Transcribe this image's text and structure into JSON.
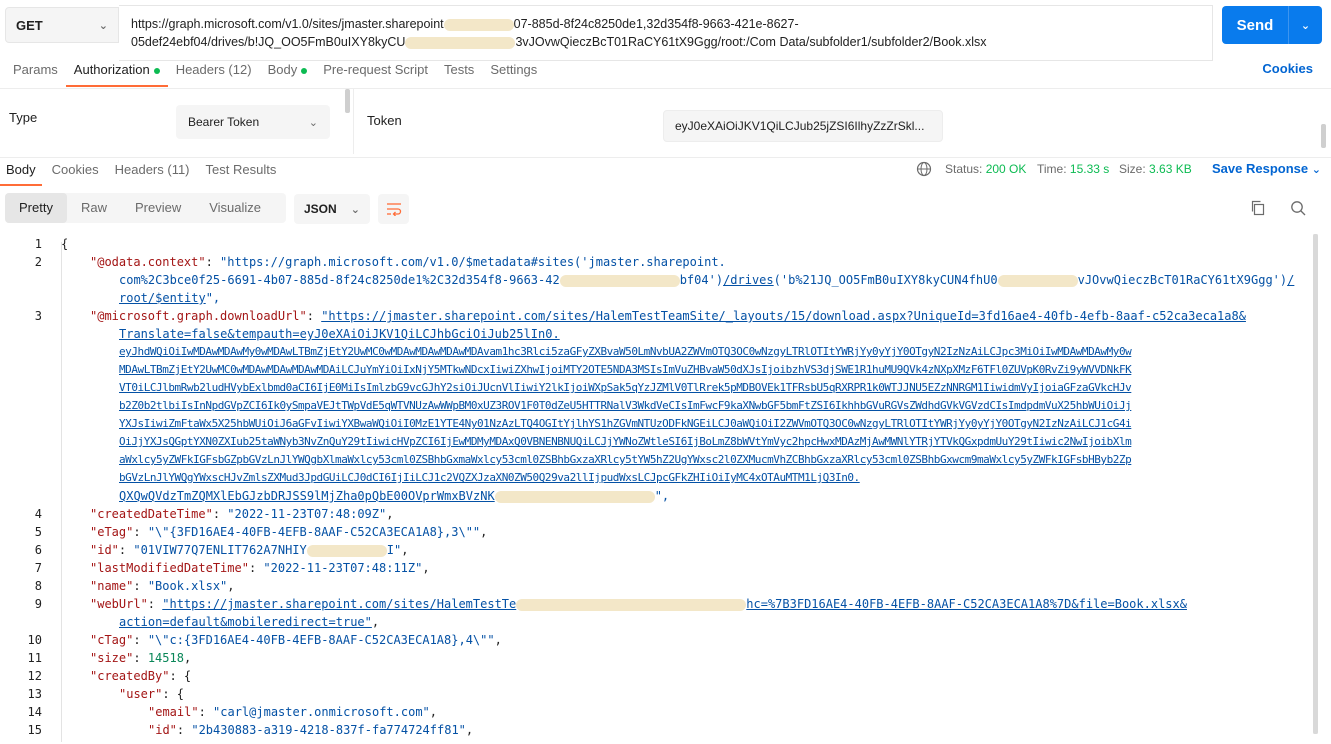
{
  "request": {
    "method": "GET",
    "url_part1": "https://graph.microsoft.com/v1.0/sites/jmaster.sharepoint",
    "url_part2": "07-885d-8f24c8250de1,32d354f8-9663-421e-8627-",
    "url_part3": "05def24ebf04/drives/b!JQ_OO5FmB0uIXY8kyCU",
    "url_part4": "3vJOvwQieczBcT01RaCY61tX9Ggg/root:/Com Data/subfolder1/subfolder2/Book.xlsx",
    "send_label": "Send"
  },
  "request_tabs": {
    "params": "Params",
    "authorization": "Authorization",
    "headers": "Headers (12)",
    "body": "Body",
    "prerequest": "Pre-request Script",
    "tests": "Tests",
    "settings": "Settings",
    "cookies": "Cookies"
  },
  "auth": {
    "type_label": "Type",
    "type_value": "Bearer Token",
    "token_label": "Token",
    "token_value": "eyJ0eXAiOiJKV1QiLCJub25jZSI6IlhyZzZrSkl..."
  },
  "response_tabs": {
    "body": "Body",
    "cookies": "Cookies",
    "headers": "Headers (11)",
    "test_results": "Test Results"
  },
  "response_status": {
    "status_label": "Status:",
    "status_value": "200 OK",
    "time_label": "Time:",
    "time_value": "15.33 s",
    "size_label": "Size:",
    "size_value": "3.63 KB",
    "save_response": "Save Response"
  },
  "toolbar": {
    "pretty": "Pretty",
    "raw": "Raw",
    "preview": "Preview",
    "visualize": "Visualize",
    "format": "JSON"
  },
  "code": {
    "l1": "{",
    "l2_key": "\"@odata.context\"",
    "l2_a": "\"https://graph.microsoft.com/v1.0/$metadata#sites('jmaster.sharepoint.",
    "l2_b": "com%2C3bce0f25-6691-4b07-885d-8f24c8250de1%2C32d354f8-9663-42",
    "l2_c": "bf04')",
    "l2_d": "/drives",
    "l2_e": "('b%21JQ_OO5FmB0uIXY8kyCUN4fhU0",
    "l2_f": "vJOvwQieczBcT01RaCY61tX9Ggg')",
    "l2_g": "/",
    "l2_h": "root/$entity",
    "l2_i": "\",",
    "l3_key": "\"@microsoft.graph.downloadUrl\"",
    "l3_1": "\"https://jmaster.sharepoint.com/sites/HalemTestTeamSite/_layouts/15/download.aspx?UniqueId=3fd16ae4-40fb-4efb-8aaf-c52ca3eca1a8&",
    "l3_2": "Translate=false&tempauth=eyJ0eXAiOiJKV1QiLCJhbGciOiJub25lIn0.",
    "l3_3": "eyJhdWQiOiIwMDAwMDAwMy0wMDAwLTBmZjEtY2UwMC0wMDAwMDAwMDAwMDAvam1hc3Rlci5zaGFyZXBvaW50LmNvbUA2ZWVmOTQ3OC0wNzgyLTRlOTItYWRjYy0yYjY0OTgyN2IzNzAiLCJpc3MiOiIwMDAwMDAwMy0w",
    "l3_4": "MDAwLTBmZjEtY2UwMC0wMDAwMDAwMDAwMDAiLCJuYmYiOiIxNjY5MTkwNDcxIiwiZXhwIjoiMTY2OTE5NDA3MSIsImVuZHBvaW50dXJsIjoibzhVS3djSWE1R1huMU9QVk4zNXpXMzF6TFl0ZUVpK0RvZi9yWVVDNkFK",
    "l3_5": "VT0iLCJlbmRwb2ludHVybExlbmd0aCI6IjE0MiIsImlzbG9vcGJhY2siOiJUcnVlIiwiY2lkIjoiWXpSak5qYzJZMlV0TlRrek5pMDBOVEk1TFRsbU5qRXRPR1k0WTJJNU5EZzNNRGM1IiwidmVyIjoiaGFzaGVkcHJv",
    "l3_6": "b2Z0b2tlbiIsInNpdGVpZCI6Ik0ySmpaVEJtTWpVdE5qWTVNUzAwWWpBM0xUZ3ROV1F0T0dZeU5HTTRNalV3WkdVeCIsImFwcF9kaXNwbGF5bmFtZSI6IkhhbGVuRGVsZWdhdGVkVGVzdCIsImdpdmVuX25hbWUiOiJj",
    "l3_7": "YXJsIiwiZmFtaWx5X25hbWUiOiJ6aGFvIiwiYXBwaWQiOiI0MzE1YTE4Ny01NzAzLTQ4OGItYjlhYS1hZGVmNTUzODFkNGEiLCJ0aWQiOiI2ZWVmOTQ3OC0wNzgyLTRlOTItYWRjYy0yYjY0OTgyN2IzNzAiLCJ1cG4i",
    "l3_8": "OiJjYXJsQGptYXN0ZXIub25taWNyb3NvZnQuY29tIiwicHVpZCI6IjEwMDMyMDAxQ0VBNENBNUQiLCJjYWNoZWtleSI6IjBoLmZ8bWVtYmVyc2hpcHwxMDAzMjAwMWNlYTRjYTVkQGxpdmUuY29tIiwic2NwIjoibXlm",
    "l3_9": "aWxlcy5yZWFkIGFsbGZpbGVzLnJlYWQgbXlmaWxlcy53cml0ZSBhbGxmaWxlcy53cml0ZSBhbGxzaXRlcy5tYW5hZ2UgYWxsc2l0ZXMucmVhZCBhbGxzaXRlcy53cml0ZSBhbGxwcm9maWxlcy5yZWFkIGFsbHByb2Zp",
    "l3_10": "bGVzLnJlYWQgYWxscHJvZmlsZXMud3JpdGUiLCJ0dCI6IjIiLCJ1c2VQZXJzaXN0ZW50Q29va2llIjpudWxsLCJpcGFkZHIiOiIyMC4xOTAuMTM1LjQ3In0.",
    "l3_11": "QXQwQVdzTmZQMXlEbGJzbDRJSS9lMjZha0pQbE00OVprWmxBVzNK",
    "l3_12": "\",",
    "l4_key": "\"createdDateTime\"",
    "l4_val": "\"2022-11-23T07:48:09Z\"",
    "l5_key": "\"eTag\"",
    "l5_val": "\"\\\"{3FD16AE4-40FB-4EFB-8AAF-C52CA3ECA1A8},3\\\"\"",
    "l6_key": "\"id\"",
    "l6_val_a": "\"01VIW77Q7ENLIT762A7NHIY",
    "l6_val_b": "I\"",
    "l7_key": "\"lastModifiedDateTime\"",
    "l7_val": "\"2022-11-23T07:48:11Z\"",
    "l8_key": "\"name\"",
    "l8_val": "\"Book.xlsx\"",
    "l9_key": "\"webUrl\"",
    "l9_a": "\"https://jmaster.sharepoint.com/sites/HalemTestTe",
    "l9_b": "hc=%7B3FD16AE4-40FB-4EFB-8AAF-C52CA3ECA1A8%7D&file=Book.xlsx&",
    "l9_c": "action=default&mobileredirect=true\"",
    "l10_key": "\"cTag\"",
    "l10_val": "\"\\\"c:{3FD16AE4-40FB-4EFB-8AAF-C52CA3ECA1A8},4\\\"\"",
    "l11_key": "\"size\"",
    "l11_val": "14518",
    "l12_key": "\"createdBy\"",
    "l13_key": "\"user\"",
    "l14_key": "\"email\"",
    "l14_val": "\"carl@jmaster.onmicrosoft.com\"",
    "l15_key": "\"id\"",
    "l15_val": "\"2b430883-a319-4218-837f-fa774724ff81\""
  },
  "icons": [
    "chevron-down-icon",
    "globe-icon",
    "copy-icon",
    "search-icon",
    "wrap-lines-icon"
  ],
  "colors": {
    "send": "#097bed",
    "active_tab": "#ff6c37",
    "status_ok": "#0cbb52",
    "link": "#0265d2"
  }
}
